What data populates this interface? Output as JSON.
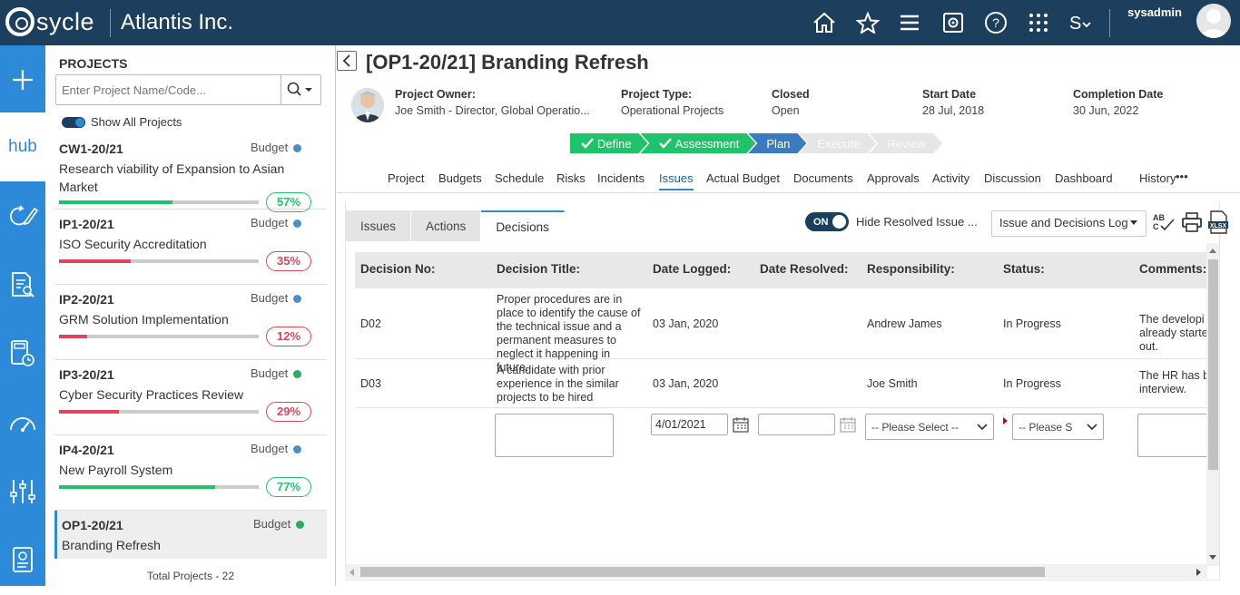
{
  "header": {
    "logo_text": "sycle",
    "company": "Atlantis Inc.",
    "username": "sysadmin",
    "icons": [
      "home-icon",
      "star-icon",
      "menu-icon",
      "settings-icon",
      "help-icon",
      "apps-icon",
      "currency-icon"
    ]
  },
  "rail": {
    "hub_label": "hub",
    "icons": [
      "plus-icon",
      "hub-icon",
      "refresh-edit-icon",
      "search-doc-icon",
      "calculator-clock-icon",
      "gauge-icon",
      "sliders-icon",
      "report-icon"
    ]
  },
  "projects": {
    "title": "PROJECTS",
    "search_placeholder": "Enter Project Name/Code...",
    "show_all": "Show All Projects",
    "total": "Total Projects - 22",
    "items": [
      {
        "code": "CW1-20/21",
        "budget": "Budget",
        "name": "Research viability of Expansion to Asian Market",
        "pct": "57%",
        "progress": 0.57,
        "dot": "#4a90c8",
        "status": "green"
      },
      {
        "code": "IP1-20/21",
        "budget": "Budget",
        "name": "ISO Security Accreditation",
        "pct": "35%",
        "progress": 0.36,
        "dot": "#4a90c8",
        "status": "red"
      },
      {
        "code": "IP2-20/21",
        "budget": "Budget",
        "name": "GRM Solution Implementation",
        "pct": "12%",
        "progress": 0.14,
        "dot": "#4a90c8",
        "status": "red"
      },
      {
        "code": "IP3-20/21",
        "budget": "Budget",
        "name": "Cyber Security Practices Review",
        "pct": "29%",
        "progress": 0.3,
        "dot": "#27ae60",
        "status": "red"
      },
      {
        "code": "IP4-20/21",
        "budget": "Budget",
        "name": "New Payroll System",
        "pct": "77%",
        "progress": 0.78,
        "dot": "#4a90c8",
        "status": "green"
      },
      {
        "code": "OP1-20/21",
        "budget": "Budget",
        "name": "Branding Refresh",
        "pct": "",
        "progress": 0,
        "dot": "#27ae60",
        "status": "green"
      }
    ]
  },
  "project": {
    "title": "[OP1-20/21] Branding Refresh",
    "owner_label": "Project Owner:",
    "owner_value": "Joe Smith - Director, Global Operatio...",
    "type_label": "Project Type:",
    "type_value": "Operational Projects",
    "closed_label": "Closed",
    "closed_value": "Open",
    "start_label": "Start Date",
    "start_value": "28 Jul, 2018",
    "completion_label": "Completion Date",
    "completion_value": "30 Jun, 2022",
    "stages": [
      {
        "label": "Define",
        "state": "done"
      },
      {
        "label": "Assessment",
        "state": "done"
      },
      {
        "label": "Plan",
        "state": "cur"
      },
      {
        "label": "Execute",
        "state": "todo"
      },
      {
        "label": "Review",
        "state": "todo"
      }
    ],
    "tabs": [
      "Project",
      "Budgets",
      "Schedule",
      "Risks",
      "Incidents",
      "Issues",
      "Actual Budget",
      "Documents",
      "Approvals",
      "Activity",
      "Discussion",
      "Dashboard",
      "History",
      "•••"
    ],
    "active_tab": "Issues"
  },
  "issues_panel": {
    "subtabs": [
      "Issues",
      "Actions",
      "Decisions"
    ],
    "active_subtab": "Decisions",
    "toggle_on": "ON",
    "hide_resolved": "Hide Resolved Issue ...",
    "log_select": "Issue and Decisions Log",
    "columns": [
      "Decision No:",
      "Decision Title:",
      "Date Logged:",
      "Date Resolved:",
      "Responsibility:",
      "Status:",
      "Comments:"
    ],
    "rows": [
      {
        "no": "D02",
        "title": "Proper procedures are in place to identify the cause of the technical issue and a permanent measures to neglect it happening in future.",
        "logged": "03 Jan, 2020",
        "resolved": "",
        "resp": "Andrew James",
        "status": "In Progress",
        "comments": "The developi already starte out."
      },
      {
        "no": "D03",
        "title": "A candidate with prior experience in the similar projects to be hired",
        "logged": "03 Jan, 2020",
        "resolved": "",
        "resp": "Joe Smith",
        "status": "In Progress",
        "comments": "The HR has b interview."
      }
    ],
    "new_row": {
      "date_logged": "4/01/2021",
      "resp_placeholder": "-- Please Select --",
      "status_placeholder": "-- Please S"
    }
  },
  "colors": {
    "topbar": "#1d3f5e",
    "rail": "#2c8ad8",
    "green": "#1fc36a",
    "red": "#e0455a",
    "stage_current": "#3b7bbf"
  }
}
